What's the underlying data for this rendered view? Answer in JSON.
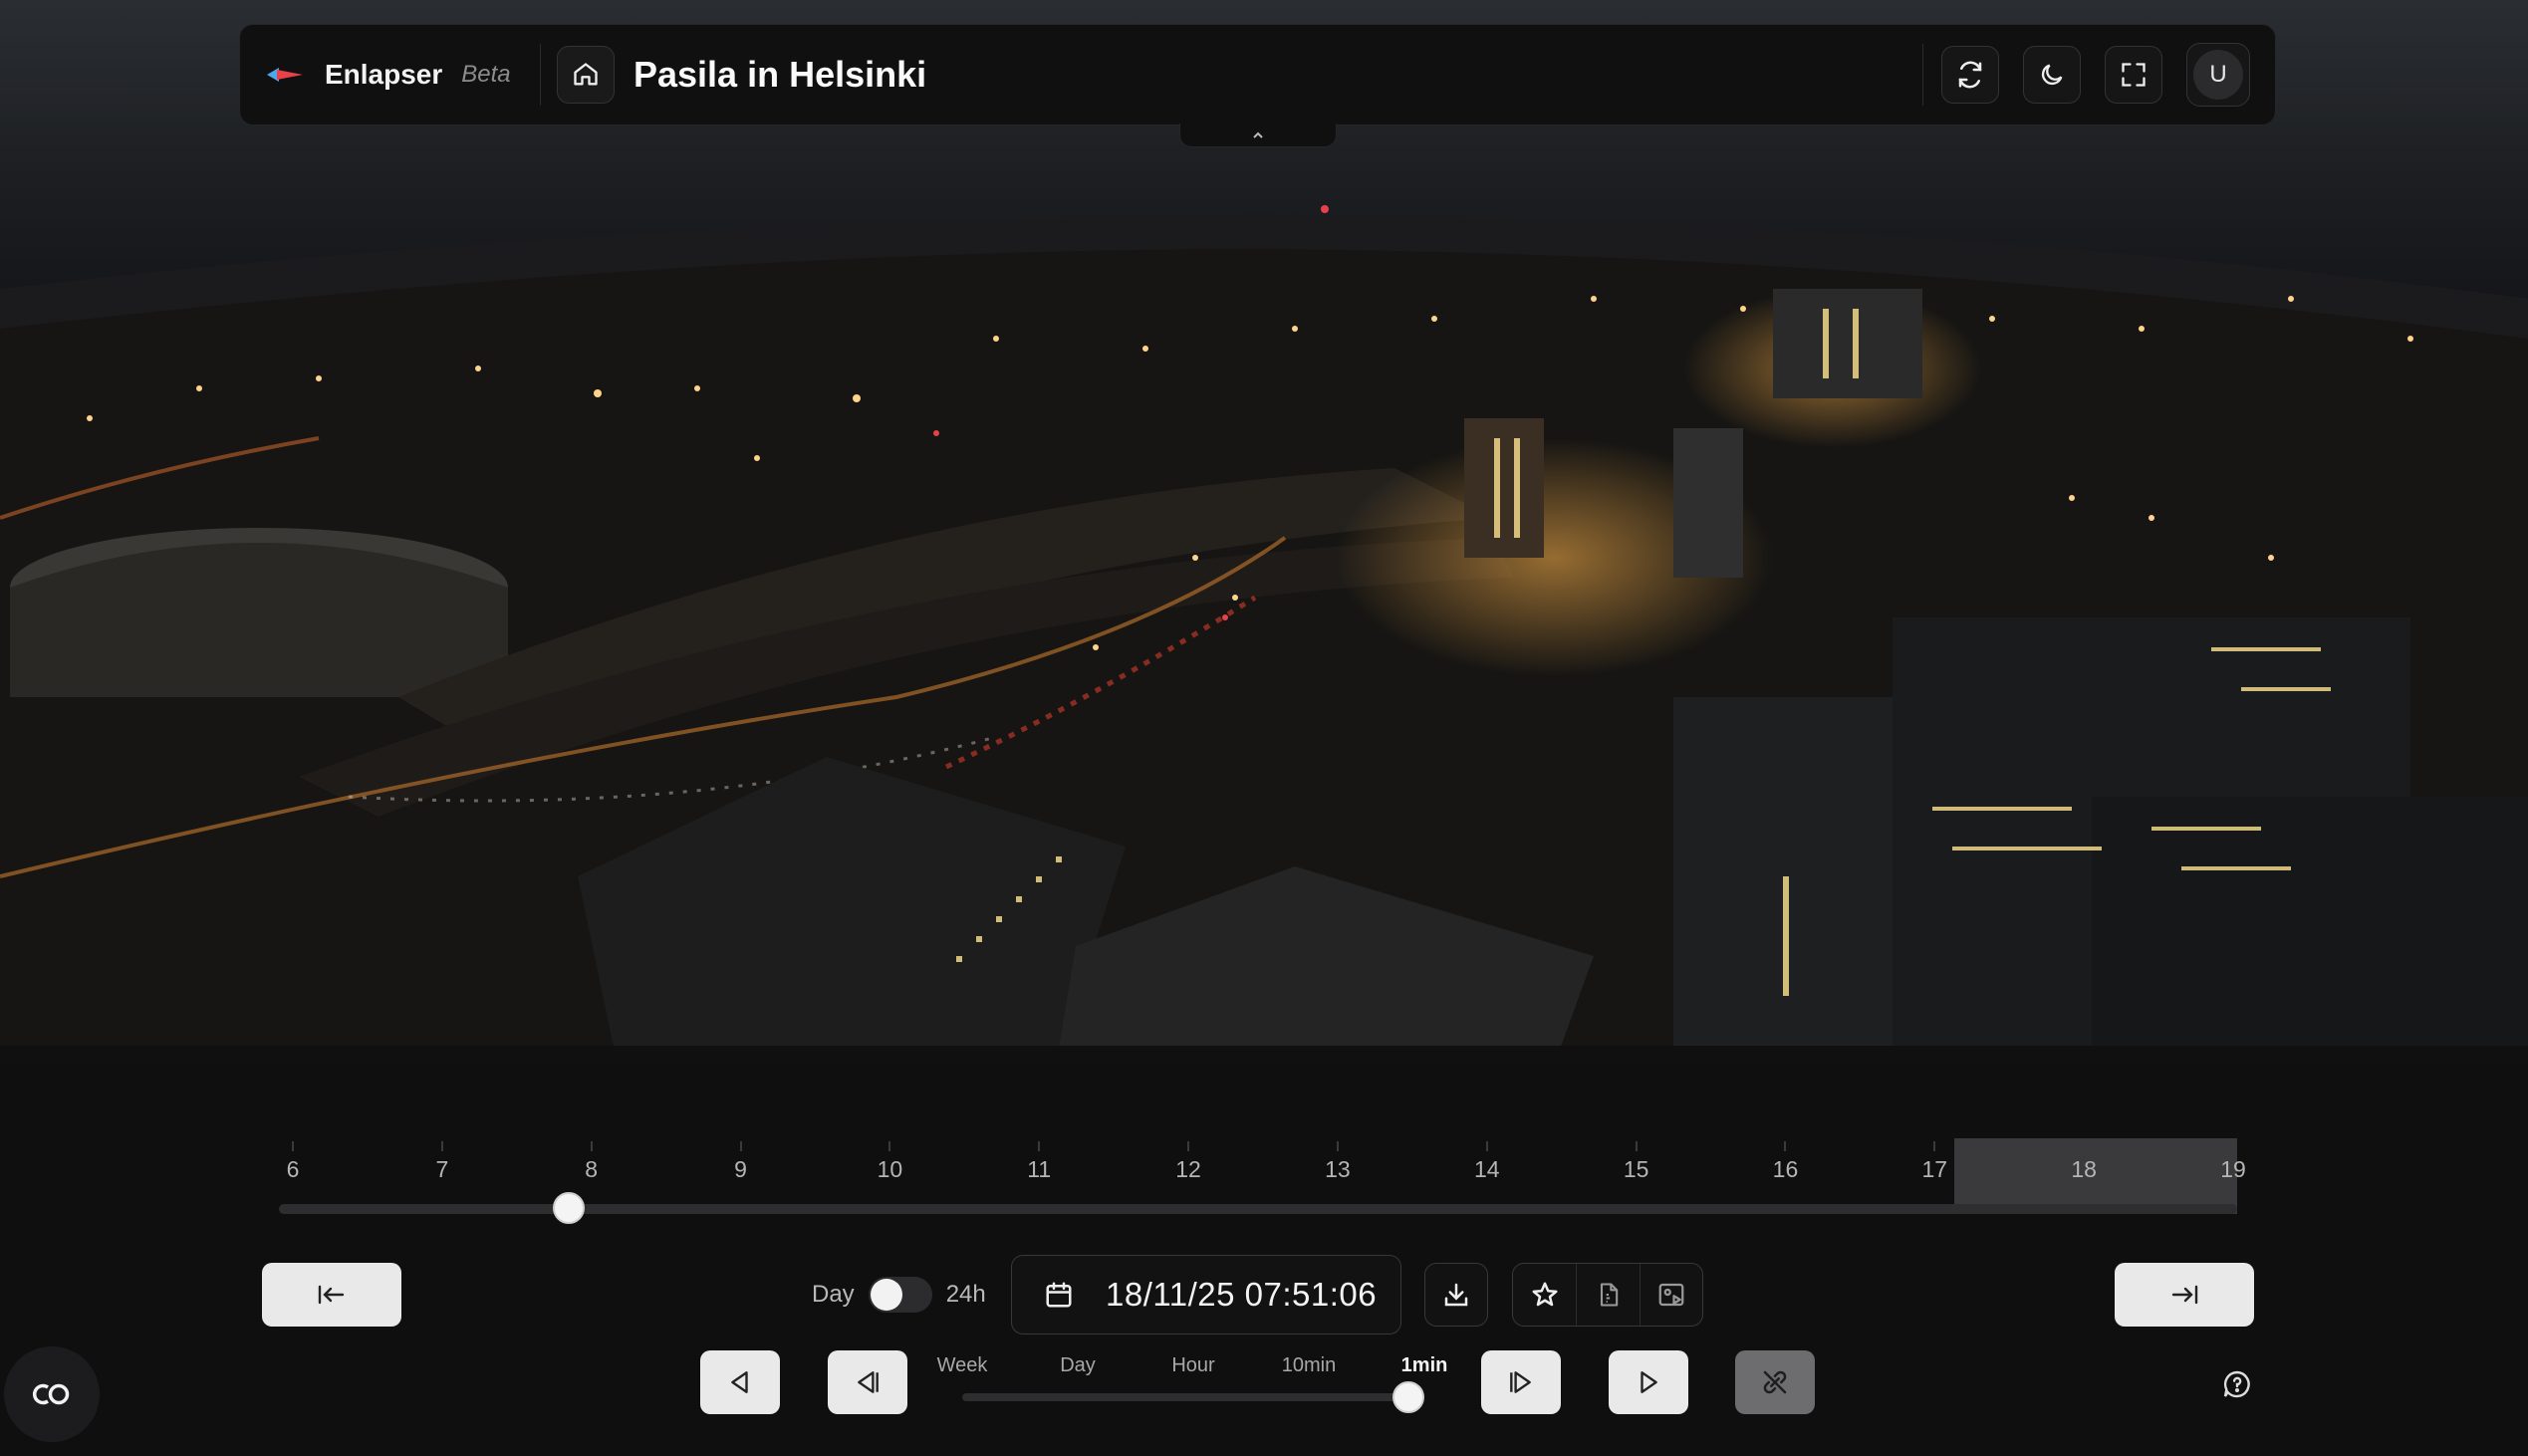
{
  "app": {
    "name": "Enlapser",
    "badge": "Beta"
  },
  "header": {
    "title": "Pasila in Helsinki",
    "avatar_initial": "U",
    "icons": [
      "home-icon",
      "refresh-icon",
      "moon-icon",
      "fullscreen-icon",
      "chevron-up-icon"
    ]
  },
  "timeline": {
    "hours": [
      "6",
      "7",
      "8",
      "9",
      "10",
      "11",
      "12",
      "13",
      "14",
      "15",
      "16",
      "17",
      "18",
      "19"
    ],
    "unavailable_from_hour": 17.2,
    "position_hour": 7.95
  },
  "view_toggle": {
    "left_label": "Day",
    "right_label": "24h",
    "on": false
  },
  "datetime": {
    "value": "18/11/25 07:51:06"
  },
  "step": {
    "options": [
      "Week",
      "Day",
      "Hour",
      "10min",
      "1min"
    ],
    "selected": "1min"
  },
  "icons": {
    "jump_start": "jump-to-start-icon",
    "jump_end": "jump-to-end-icon",
    "calendar": "calendar-icon",
    "download": "download-icon",
    "favorite": "star-icon",
    "pdf": "file-export-icon",
    "image": "image-export-icon",
    "prev": "step-back-icon",
    "play_back": "play-backward-icon",
    "play_forward": "play-forward-icon",
    "next": "step-forward-icon",
    "link": "link-off-icon",
    "help": "help-icon",
    "badge": "loop-badge-icon"
  },
  "colors": {
    "background": "#0f0f0f",
    "button_light": "#e9e9ea",
    "accent_red": "#e8414a",
    "accent_blue": "#4aa8f0"
  }
}
